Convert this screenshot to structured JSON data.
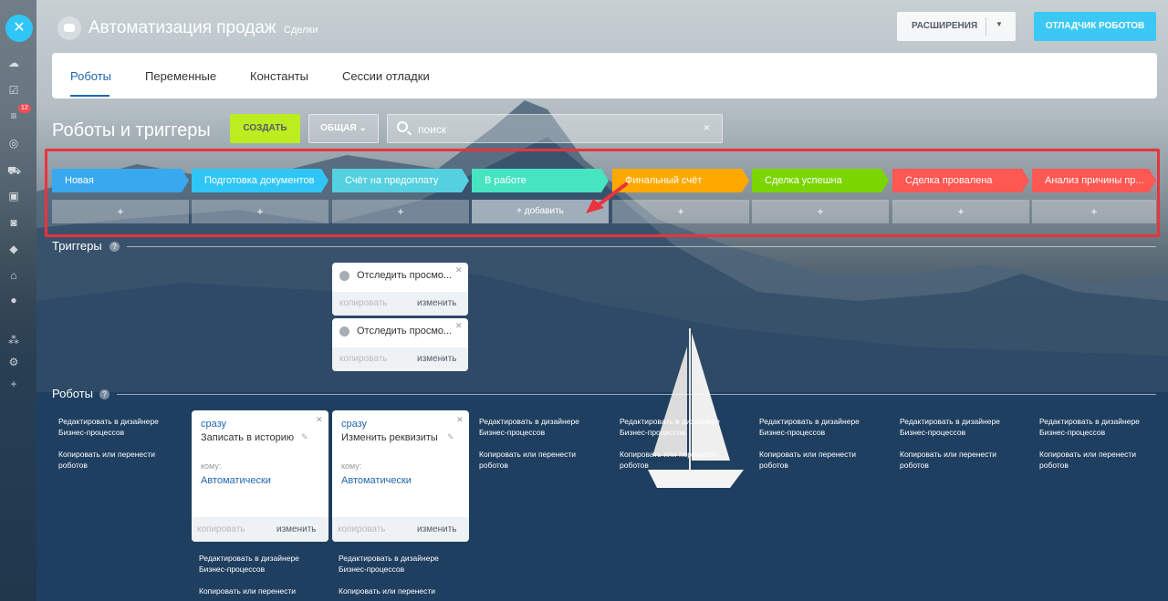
{
  "header": {
    "title": "Автоматизация продаж",
    "subtitle": "Сделки",
    "extensions_label": "РАСШИРЕНИЯ",
    "debugger_label": "ОТЛАДЧИК РОБОТОВ"
  },
  "sidebar": {
    "badge": "12"
  },
  "tabs": [
    {
      "label": "Роботы",
      "active": true
    },
    {
      "label": "Переменные",
      "active": false
    },
    {
      "label": "Константы",
      "active": false
    },
    {
      "label": "Сессии отладки",
      "active": false
    }
  ],
  "toolbar": {
    "section_title": "Роботы и триггеры",
    "create_label": "СОЗДАТЬ",
    "general_label": "ОБЩАЯ",
    "search_value": "поиск",
    "clear_symbol": "×"
  },
  "stages": [
    {
      "name": "Новая",
      "color": "#39a8ef"
    },
    {
      "name": "Подготовка документов",
      "color": "#2fc6f6"
    },
    {
      "name": "Счёт на предоплату",
      "color": "#55d0e0"
    },
    {
      "name": "В работе",
      "color": "#47e4c2"
    },
    {
      "name": "Финальный счёт",
      "color": "#ffa900"
    },
    {
      "name": "Сделка успешна",
      "color": "#7bd500"
    },
    {
      "name": "Сделка провалена",
      "color": "#ff5752"
    },
    {
      "name": "Анализ причины пр...",
      "color": "#ff5752"
    }
  ],
  "add": {
    "plus": "+",
    "labelled": "+ добавить"
  },
  "triggers_section": {
    "title": "Триггеры"
  },
  "triggers": [
    {
      "name": "Отследить просмо...",
      "copy": "копировать",
      "edit": "изменить"
    },
    {
      "name": "Отследить просмо...",
      "copy": "копировать",
      "edit": "изменить"
    }
  ],
  "robots_section": {
    "title": "Роботы"
  },
  "robot_links": {
    "edit_designer": "Редактировать в дизайнере Бизнес-процессов",
    "copy_move": "Копировать или перенести роботов",
    "copy_move_cut": "Копировать или перенести"
  },
  "robots": [
    {
      "when": "сразу",
      "name": "Записать в историю",
      "whom_label": "кому:",
      "whom": "Автоматически",
      "copy": "копировать",
      "edit": "изменить"
    },
    {
      "when": "сразу",
      "name": "Изменить реквизиты",
      "whom_label": "кому:",
      "whom": "Автоматически",
      "copy": "копировать",
      "edit": "изменить"
    }
  ],
  "help": "?",
  "colors": {
    "accent": "#2067b0",
    "create": "#bbed21",
    "debug": "#3bc8f5",
    "highlight": "#e8343d"
  }
}
